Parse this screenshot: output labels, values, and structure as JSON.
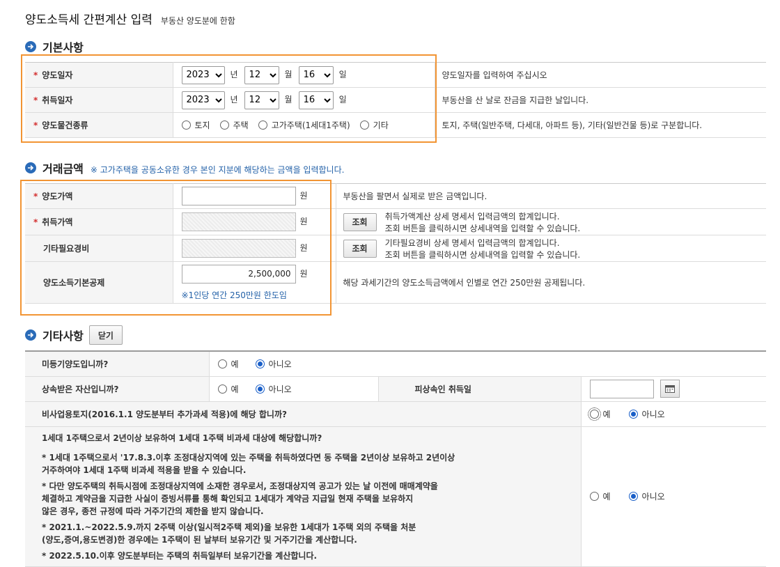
{
  "page": {
    "title": "양도소득세 간편계산 입력",
    "subtitle": "부동산 양도분에 한함"
  },
  "basic": {
    "title": "기본사항",
    "rows": [
      {
        "label": "양도일자",
        "year": "2023",
        "month": "12",
        "day": "16",
        "year_unit": "년",
        "month_unit": "월",
        "day_unit": "일",
        "desc": "양도일자를 입력하여 주십시오"
      },
      {
        "label": "취득일자",
        "year": "2023",
        "month": "12",
        "day": "16",
        "year_unit": "년",
        "month_unit": "월",
        "day_unit": "일",
        "desc": "부동산을 산 날로 잔금을 지급한 날입니다."
      }
    ],
    "type_row": {
      "label": "양도물건종류",
      "options": [
        "토지",
        "주택",
        "고가주택(1세대1주택)",
        "기타"
      ],
      "desc": "토지, 주택(일반주택, 다세대, 아파트 등), 기타(일반건물 등)로 구분합니다."
    }
  },
  "amount": {
    "title": "거래금액",
    "note": "※ 고가주택을 공동소유한 경우 본인 지분에 해당하는 금액을 입력합니다.",
    "unit": "원",
    "lookup_label": "조회",
    "rows": [
      {
        "label": "양도가액",
        "value": "",
        "desc1": "부동산을 팔면서 실제로 받은 금액입니다.",
        "desc2": ""
      },
      {
        "label": "취득가액",
        "value": "",
        "desc1": "취득가액계산 상세 명세서 입력금액의 합계입니다.",
        "desc2": "조회 버튼을 클릭하시면 상세내역을 입력할 수 있습니다."
      },
      {
        "label": "기타필요경비",
        "value": "",
        "desc1": "기타필요경비 상세 명세서 입력금액의 합계입니다.",
        "desc2": "조회 버튼을 클릭하시면 상세내역을 입력할 수 있습니다."
      },
      {
        "label": "양도소득기본공제",
        "value": "2,500,000",
        "note": "※1인당 연간 250만원 한도임",
        "desc1": "해당 과세기간의 양도소득금액에서 인별로 연간 250만원 공제됩니다.",
        "desc2": ""
      }
    ]
  },
  "other": {
    "title": "기타사항",
    "close_label": "닫기",
    "yes": "예",
    "no": "아니오",
    "q1": "미등기양도입니까?",
    "q2": "상속받은 자산입니까?",
    "q2_side_label": "피상속인 취득일",
    "q3": "비사업용토지(2016.1.1 양도분부터 추가과세 적용)에 해당 합니까?",
    "q4_title": "1세대 1주택으로서 2년이상 보유하여 1세대 1주택 비과세 대상에 해당합니까?",
    "q4_p1a": "* 1세대 1주택으로서 '17.8.3.이후 조정대상지역에 있는 주택을 취득하였다면 동 주택을 2년이상 보유하고 2년이상",
    "q4_p1b": "거주하여야 1세대 1주택 비과세 적용을 받을 수 있습니다.",
    "q4_p2a": "* 다만 양도주택의 취득시점에 조정대상지역에 소재한 경우로서, 조정대상지역 공고가 있는 날 이전에 매매계약을",
    "q4_p2b": "체결하고 계약금을 지급한 사실이 증빙서류를 통해 확인되고 1세대가 계약금 지급일 현재 주택을 보유하지",
    "q4_p2c": "않은 경우, 종전 규정에 따라 거주기간의 제한을 받지 않습니다.",
    "q4_p3a": "* 2021.1.~2022.5.9.까지 2주택 이상(일시적2주택 제외)을 보유한 1세대가 1주택 외의 주택을 처분",
    "q4_p3b": "(양도,증여,용도변경)한 경우에는 1주택이 된 날부터 보유기간 및 거주기간을 계산합니다.",
    "q4_p4": "* 2022.5.10.이후 양도분부터는 주택의 취득일부터 보유기간을 계산합니다."
  },
  "colors": {
    "accent": "#2a6bb8",
    "required": "#d32f2f",
    "highlight": "#f29433",
    "note": "#2361a8"
  }
}
